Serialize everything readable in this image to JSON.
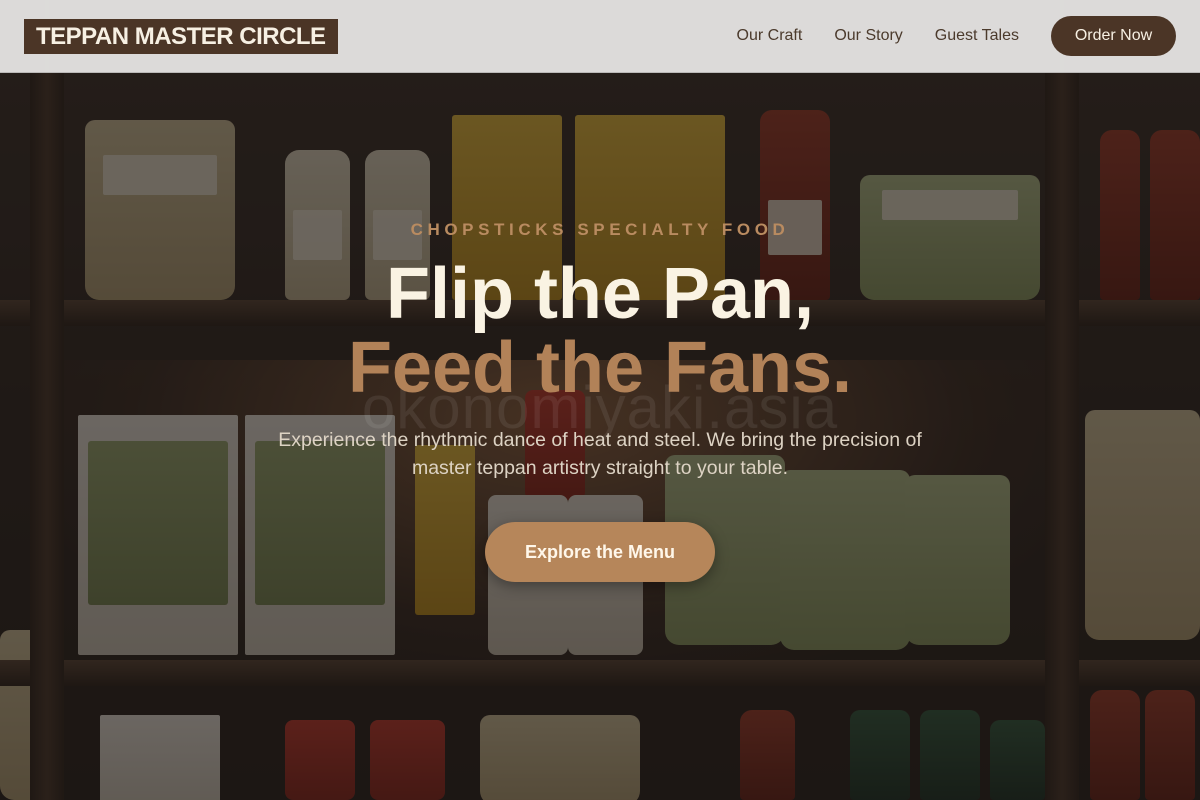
{
  "nav": {
    "brand": "TEPPAN MASTER CIRCLE",
    "links": [
      "Our Craft",
      "Our Story",
      "Guest Tales"
    ],
    "order_label": "Order Now"
  },
  "hero": {
    "kicker": "CHOPSTICKS SPECIALTY FOOD",
    "title_line1": "Flip the Pan,",
    "title_line2": "Feed the Fans.",
    "watermark": "okonomiyaki.asia",
    "lead": "Experience the rhythmic dance of heat and steel. We bring the precision of master teppan artistry straight to your table.",
    "cta_label": "Explore the Menu"
  },
  "colors": {
    "brand_brown": "#4b3526",
    "accent_tan": "#b6865a",
    "title_cream": "#faf3e3",
    "nav_bg": "#e8e7e5"
  }
}
